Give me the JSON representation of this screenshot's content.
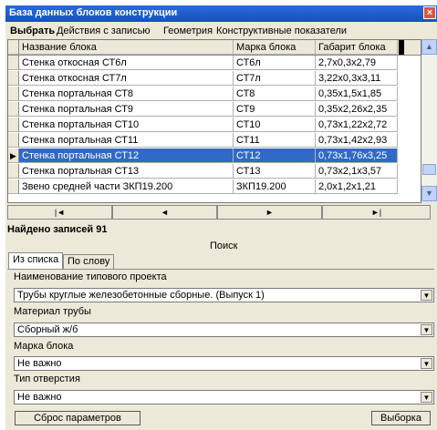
{
  "window": {
    "title": "База данных блоков конструкции",
    "close_glyph": "×"
  },
  "menu": [
    {
      "label": "Выбрать",
      "bold": true
    },
    {
      "label": "Действия с записью"
    },
    {
      "label": "Геометрия"
    },
    {
      "label": "Конструктивные показатели"
    }
  ],
  "table": {
    "columns": [
      "Название блока",
      "Марка блока",
      "Габарит блока"
    ],
    "rows": [
      [
        "Стенка откосная СТ6л",
        "СТ6л",
        "2,7x0,3x2,79"
      ],
      [
        "Стенка откосная СТ7л",
        "СТ7л",
        "3,22x0,3x3,11"
      ],
      [
        "Стенка портальная СТ8",
        "СТ8",
        "0,35x1,5x1,85"
      ],
      [
        "Стенка портальная СТ9",
        "СТ9",
        "0,35x2,26x2,35"
      ],
      [
        "Стенка портальная СТ10",
        "СТ10",
        "0,73x1,22x2,72"
      ],
      [
        "Стенка портальная СТ11",
        "СТ11",
        "0,73x1,42x2,93"
      ],
      [
        "Стенка портальная СТ12",
        "СТ12",
        "0,73x1,76x3,25"
      ],
      [
        "Стенка портальная СТ13",
        "СТ13",
        "0,73x2,1x3,57"
      ],
      [
        "Звено средней части ЗКП19.200",
        "ЗКП19.200",
        "2,0x1,2x1,21"
      ]
    ],
    "selected_index": 6,
    "current_row_glyph": "▶"
  },
  "nav": {
    "first": "|◄",
    "prev": "◄",
    "next": "►",
    "last": "►|"
  },
  "found_text": "Найдено записей 91",
  "search_label": "Поиск",
  "tabs": [
    {
      "label": "Из списка",
      "active": true
    },
    {
      "label": "По слову",
      "active": false
    }
  ],
  "fields": [
    {
      "label": "Наименование типового проекта",
      "value": "Трубы круглые железобетонные сборные. (Выпуск 1)"
    },
    {
      "label": "Материал трубы",
      "value": "Сборный ж/б"
    },
    {
      "label": "Марка блока",
      "value": "Не важно"
    },
    {
      "label": "Тип отверстия",
      "value": "Не важно"
    }
  ],
  "buttons": {
    "reset": "Сброс параметров",
    "select": "Выборка"
  },
  "colors": {
    "title_bar": "#1e5fd0",
    "selection": "#3169c6",
    "window_bg": "#ece9d8"
  }
}
